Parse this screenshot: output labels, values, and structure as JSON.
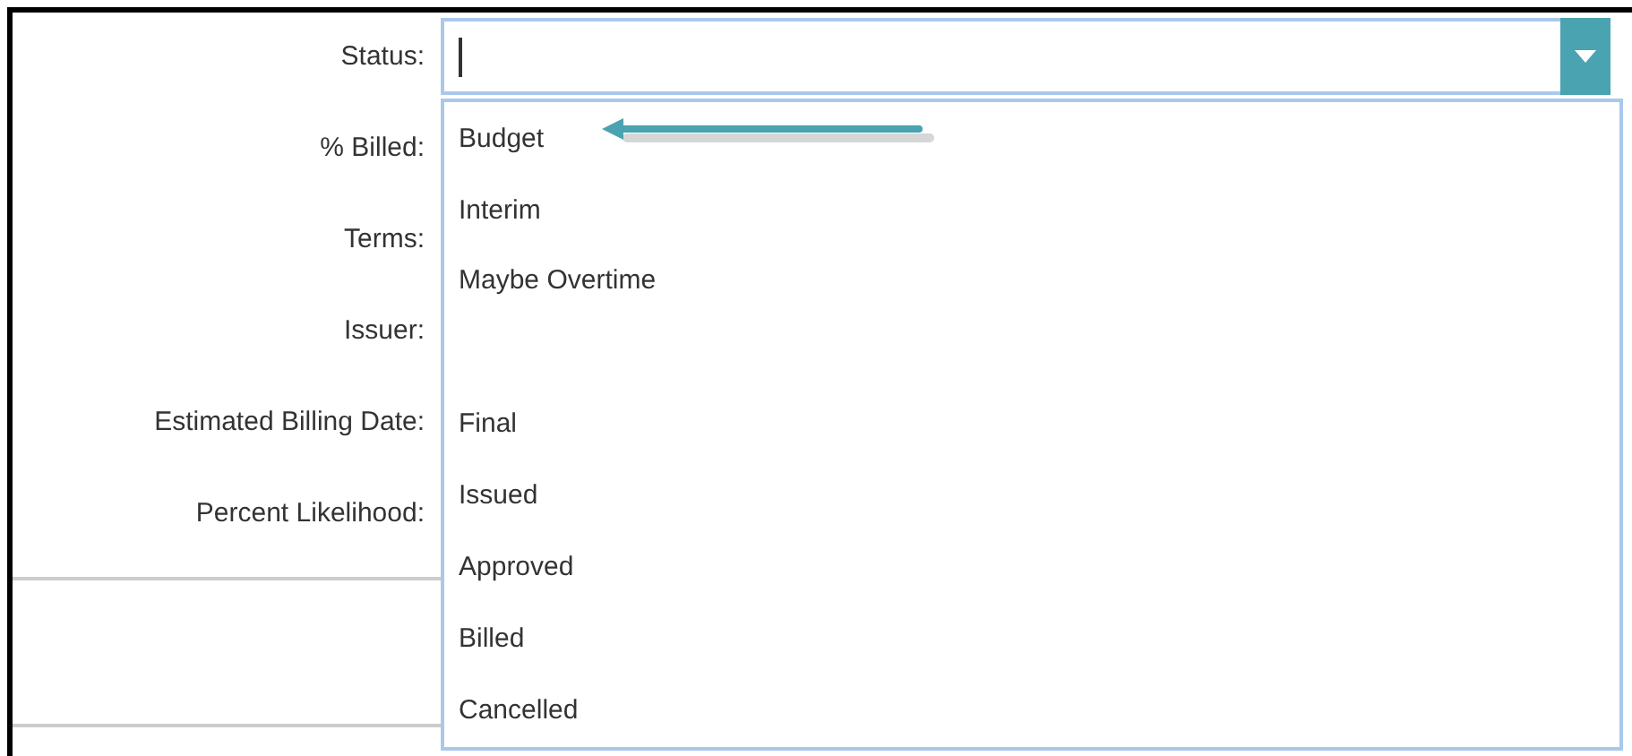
{
  "form": {
    "labels": [
      "Status:",
      "% Billed:",
      "Terms:",
      "Issuer:",
      "Estimated Billing Date:",
      "Percent Likelihood:"
    ]
  },
  "status_dropdown": {
    "expanded": true,
    "options": [
      {
        "kind": "option",
        "label": "Budget"
      },
      {
        "kind": "option",
        "label": "Interim"
      },
      {
        "kind": "option",
        "label": "Maybe Overtime"
      },
      {
        "kind": "blank"
      },
      {
        "kind": "option",
        "label": "Final"
      },
      {
        "kind": "option",
        "label": "Issued"
      },
      {
        "kind": "option",
        "label": "Approved"
      },
      {
        "kind": "option",
        "label": "Billed"
      },
      {
        "kind": "option",
        "label": "Cancelled"
      }
    ]
  }
}
